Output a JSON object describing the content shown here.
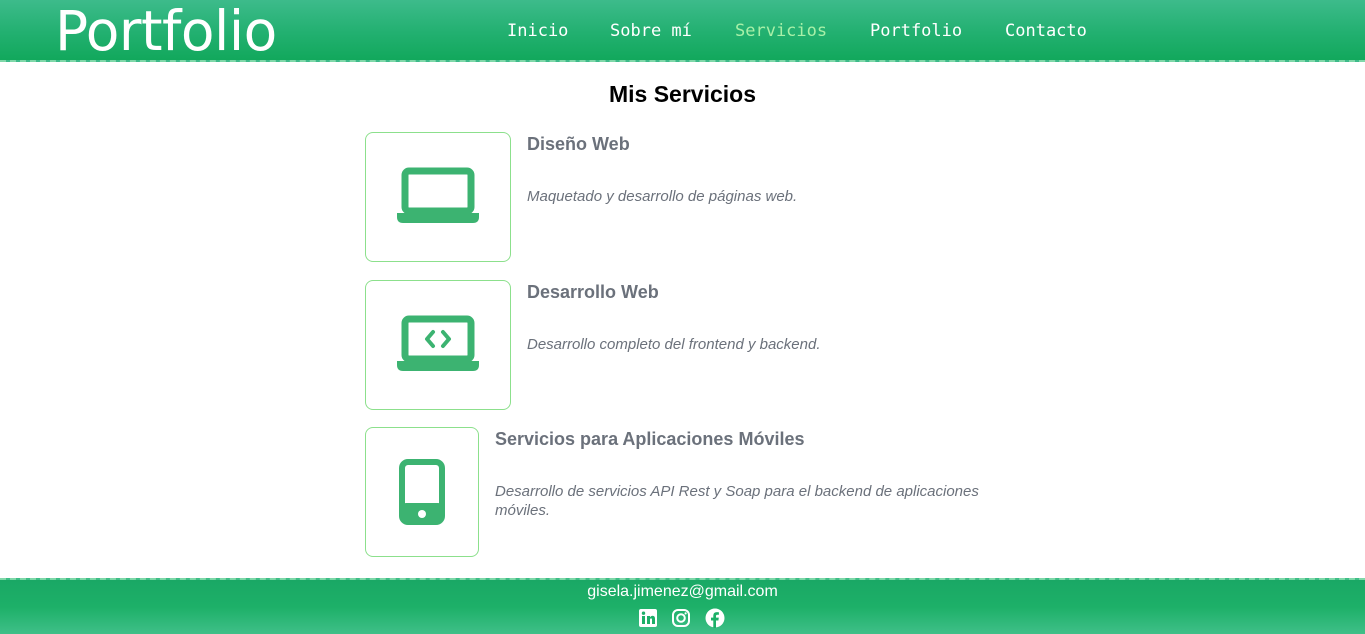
{
  "header": {
    "brand": "Portfolio",
    "nav": [
      {
        "label": "Inicio",
        "active": false
      },
      {
        "label": "Sobre mí",
        "active": false
      },
      {
        "label": "Servicios",
        "active": true
      },
      {
        "label": "Portfolio",
        "active": false
      },
      {
        "label": "Contacto",
        "active": false
      }
    ]
  },
  "main": {
    "title": "Mis Servicios",
    "services": [
      {
        "icon": "laptop-icon",
        "title": "Diseño Web",
        "description": "Maquetado y desarrollo de páginas web."
      },
      {
        "icon": "laptop-code-icon",
        "title": "Desarrollo Web",
        "description": "Desarrollo completo del frontend y backend."
      },
      {
        "icon": "mobile-phone-icon",
        "title": "Servicios para Aplicaciones Móviles",
        "description": "Desarrollo de servicios API Rest y Soap para el backend de aplicaciones móviles."
      }
    ]
  },
  "footer": {
    "email": "gisela.jimenez@gmail.com",
    "social": [
      "linkedin-icon",
      "instagram-icon",
      "facebook-icon"
    ]
  },
  "colors": {
    "header_green": "#22b070",
    "icon_green": "#3cb371",
    "active_nav": "#a8f0a8",
    "card_border": "#8ce08c",
    "text_gray": "#6b717b"
  }
}
